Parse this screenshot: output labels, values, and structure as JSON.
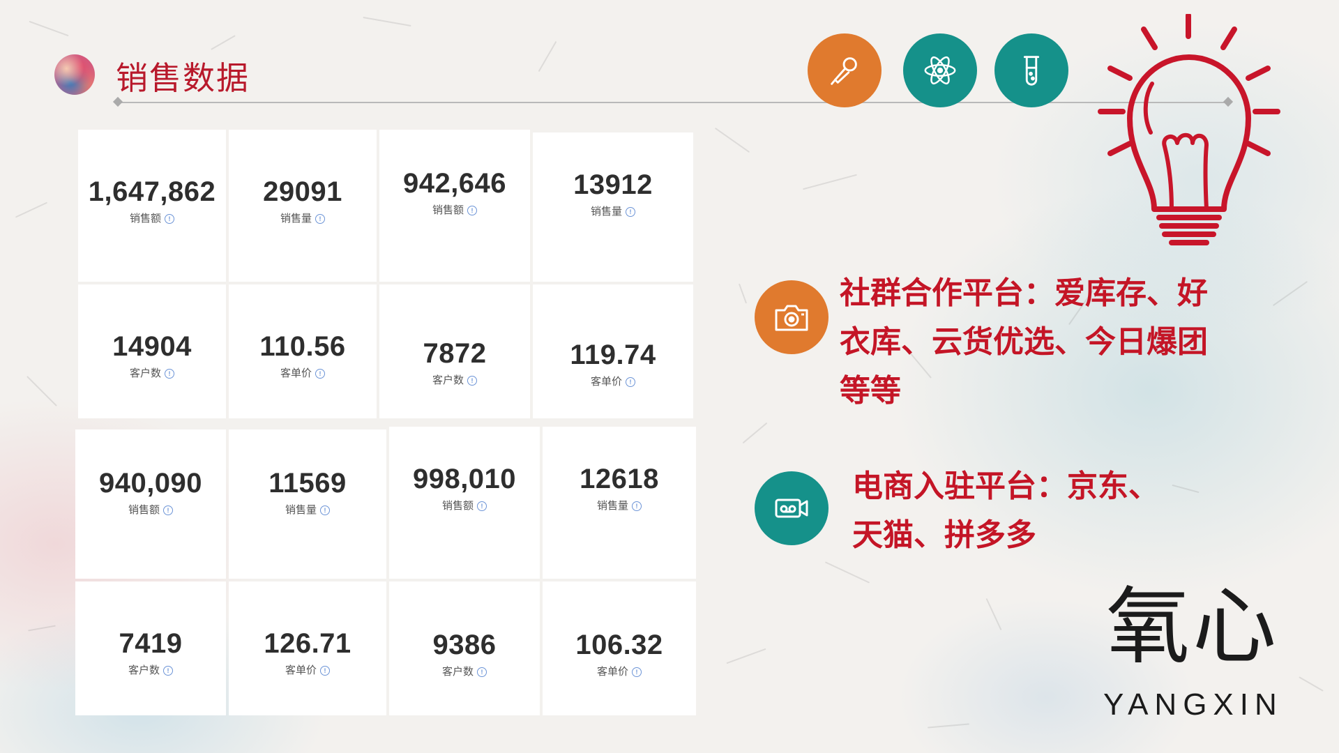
{
  "header": {
    "title": "销售数据"
  },
  "top_icons": [
    {
      "name": "microphone-icon",
      "color": "#e07a2e"
    },
    {
      "name": "atom-icon",
      "color": "#15918a"
    },
    {
      "name": "test-tube-icon",
      "color": "#15918a"
    }
  ],
  "metrics": [
    {
      "value": "1,647,862",
      "label": "销售额"
    },
    {
      "value": "29091",
      "label": "销售量"
    },
    {
      "value": "942,646",
      "label": "销售额"
    },
    {
      "value": "13912",
      "label": "销售量"
    },
    {
      "value": "14904",
      "label": "客户数"
    },
    {
      "value": "110.56",
      "label": "客单价"
    },
    {
      "value": "7872",
      "label": "客户数"
    },
    {
      "value": "119.74",
      "label": "客单价"
    },
    {
      "value": "940,090",
      "label": "销售额"
    },
    {
      "value": "11569",
      "label": "销售量"
    },
    {
      "value": "998,010",
      "label": "销售额"
    },
    {
      "value": "12618",
      "label": "销售量"
    },
    {
      "value": "7419",
      "label": "客户数"
    },
    {
      "value": "126.71",
      "label": "客单价"
    },
    {
      "value": "9386",
      "label": "客户数"
    },
    {
      "value": "106.32",
      "label": "客单价"
    }
  ],
  "features": [
    {
      "icon": "camera-icon",
      "color": "#e07a2e",
      "lines": [
        "社群合作平台：爱库存、好",
        "衣库、云货优选、今日爆团",
        "等等"
      ]
    },
    {
      "icon": "video-camera-icon",
      "color": "#15918a",
      "lines": [
        "电商入驻平台：京东、",
        "天猫、拼多多"
      ]
    }
  ],
  "brand": {
    "cn": "氧心",
    "en": "YANGXIN"
  },
  "colors": {
    "accent_red": "#c41526",
    "orange": "#e07a2e",
    "teal": "#15918a"
  }
}
